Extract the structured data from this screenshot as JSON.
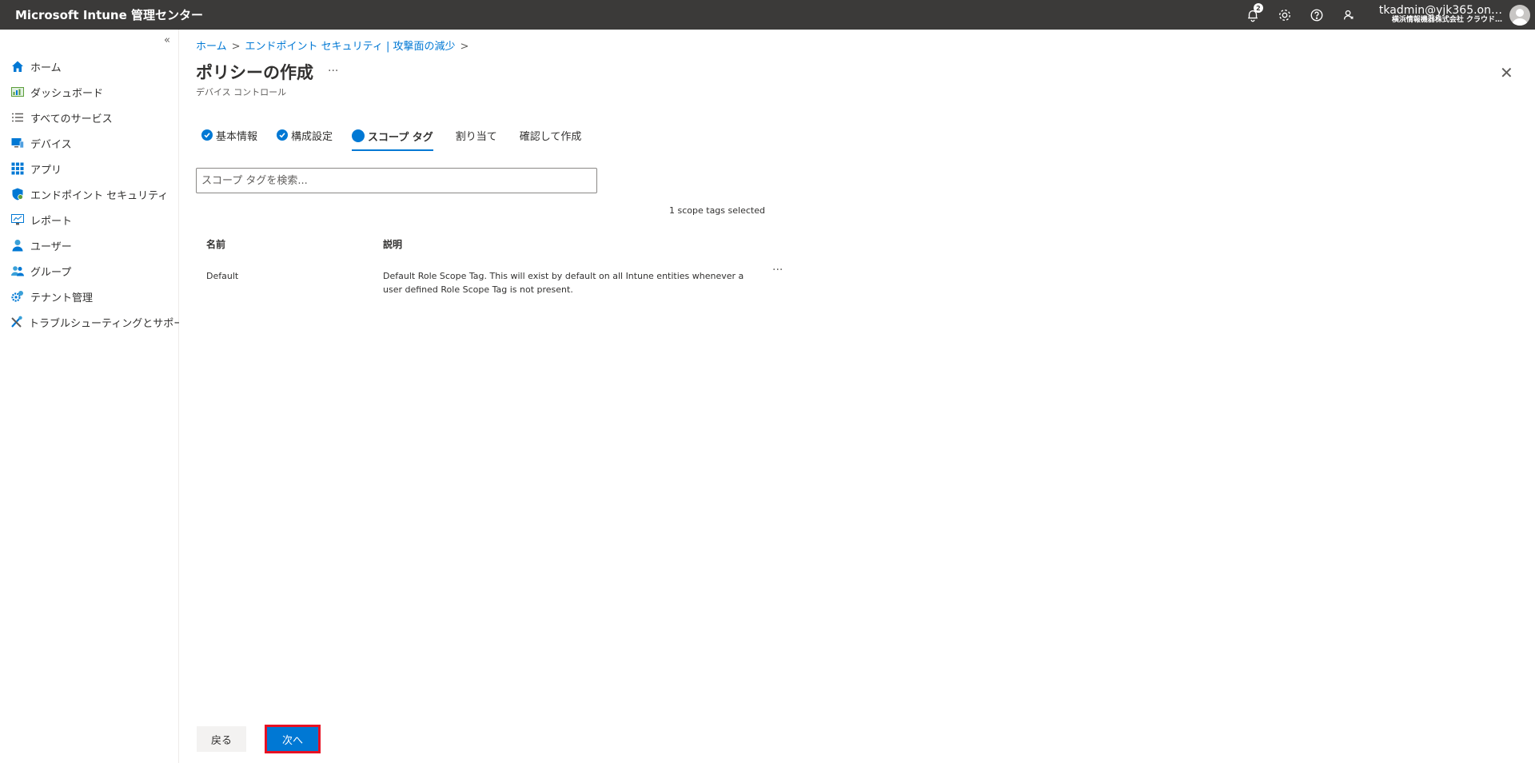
{
  "app": {
    "title": "Microsoft Intune 管理センター",
    "notification_count": "2",
    "account_name": "tkadmin@yjk365.on…",
    "account_org": "横浜情報機器株式会社 クラウド…"
  },
  "sidebar": {
    "collapse_glyph": "«",
    "items": [
      {
        "label": "ホーム",
        "icon": "home-icon"
      },
      {
        "label": "ダッシュボード",
        "icon": "dashboard-icon"
      },
      {
        "label": "すべてのサービス",
        "icon": "list-icon"
      },
      {
        "label": "デバイス",
        "icon": "device-icon"
      },
      {
        "label": "アプリ",
        "icon": "apps-grid-icon"
      },
      {
        "label": "エンドポイント セキュリティ",
        "icon": "shield-icon"
      },
      {
        "label": "レポート",
        "icon": "report-icon"
      },
      {
        "label": "ユーザー",
        "icon": "user-icon"
      },
      {
        "label": "グループ",
        "icon": "group-icon"
      },
      {
        "label": "テナント管理",
        "icon": "tenant-gear-icon"
      },
      {
        "label": "トラブルシューティングとサポート",
        "icon": "tools-icon"
      }
    ]
  },
  "breadcrumb": {
    "home": "ホーム",
    "section": "エンドポイント セキュリティ | 攻撃面の減少",
    "sep": ">"
  },
  "page": {
    "title": "ポリシーの作成",
    "more": "···",
    "subtitle": "デバイス コントロール",
    "close": "✕"
  },
  "steps": [
    {
      "label": "基本情報",
      "state": "done"
    },
    {
      "label": "構成設定",
      "state": "done"
    },
    {
      "label": "スコープ タグ",
      "state": "active"
    },
    {
      "label": "割り当て",
      "state": "pending"
    },
    {
      "label": "確認して作成",
      "state": "pending"
    }
  ],
  "search": {
    "placeholder": "スコープ タグを検索..."
  },
  "selection": {
    "text": "1 scope tags selected"
  },
  "table": {
    "columns": [
      "名前",
      "説明"
    ],
    "rows": [
      {
        "name": "Default",
        "desc_line1": "Default Role Scope Tag. This will exist by default on all Intune entities whenever a",
        "desc_line2": "user defined Role Scope Tag is not present.",
        "more": "···"
      }
    ]
  },
  "footer": {
    "back_label": "戻る",
    "next_label": "次へ"
  },
  "colors": {
    "accent": "#0078d4",
    "topbar": "#3b3a39",
    "highlight": "#e81123"
  }
}
